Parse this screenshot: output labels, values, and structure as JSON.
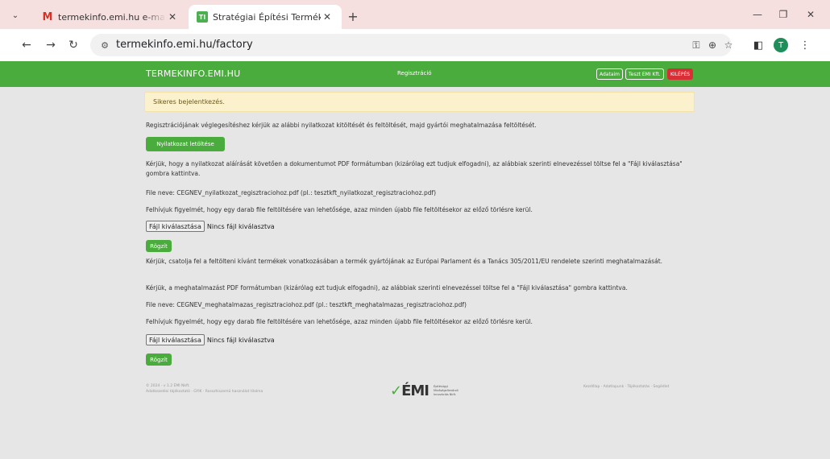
{
  "browser": {
    "tabs": [
      {
        "title": "termekinfo.emi.hu e-mailcím m",
        "active": false,
        "favicon": "gmail-icon"
      },
      {
        "title": "Stratégiai Építési Termékek",
        "active": true,
        "favicon": "TI"
      }
    ],
    "url": "termekinfo.emi.hu/factory",
    "avatar_letter": "T"
  },
  "header": {
    "brand": "TERMEKINFO.EMI.HU",
    "center_link": "Regisztráció",
    "buttons": [
      "Adataim",
      "Teszt EMI Kft.",
      "KILÉPÉS"
    ]
  },
  "alert": "Sikeres bejelentkezés.",
  "intro": "Regisztrációjának véglegesítéshez kérjük az alábbi nyilatkozat kitöltését és feltöltését, majd gyártói meghatalmazása feltöltését.",
  "download_button": "Nyilatkozat letöltése",
  "section1": {
    "instruction": "Kérjük, hogy a nyilatkozat aláírását követően a dokumentumot PDF formátumban (kizárólag ezt tudjuk elfogadni), az alábbiak szerinti elnevezéssel töltse fel a \"Fájl kiválasztása\" gombra kattintva.",
    "filename": "File neve: CEGNEV_nyilatkozat_regisztraciohoz.pdf (pl.: tesztkft_nyilatkozat_regisztraciohoz.pdf)",
    "notice": "Felhívjuk figyelmét, hogy egy darab file feltöltésére van lehetősége, azaz minden újabb file feltöltésekor az előző törlésre kerül.",
    "choose_label": "Fájl kiválasztása",
    "no_file": "Nincs fájl kiválasztva",
    "submit": "Rögzít"
  },
  "section2": {
    "attach": "Kérjük, csatolja fel a feltölteni kívánt termékek vonatkozásában a termék gyártójának az Európai Parlament és a Tanács 305/2011/EU rendelete szerinti meghatalmazását.",
    "instruction": "Kérjük, a meghatalmazást PDF formátumban (kizárólag ezt tudjuk elfogadni), az alábbiak szerinti elnevezéssel töltse fel a \"Fájl kiválasztása\" gombra kattintva.",
    "filename": "File neve: CEGNEV_meghatalmazas_regisztraciohoz.pdf (pl.: tesztkft_meghatalmazas_regisztraciohoz.pdf)",
    "notice": "Felhívjuk figyelmét, hogy egy darab file feltöltésére van lehetősége, azaz minden újabb file feltöltésekor az előző törlésre kerül.",
    "choose_label": "Fájl kiválasztása",
    "no_file": "Nincs fájl kiválasztva",
    "submit": "Rögzít"
  },
  "footer": {
    "copyright": "© 2024 - v 1.2 ÉMI Nkft.",
    "left_links": "Adatkezelési tájékoztató · GYIK · Rosszhiszemű használat tilalma",
    "logo": "ÉMI",
    "logo_sub": [
      "Építésügyi",
      "Minőségellenőrző",
      "Innovációs Nkft."
    ],
    "right_links": "Kezdőlap · Adatlapunk · Tájékoztatás · Segédlet"
  },
  "colors": {
    "header_green": "#4aac3c",
    "logout_red": "#d92e36",
    "alert_bg": "#fbf1cc"
  }
}
